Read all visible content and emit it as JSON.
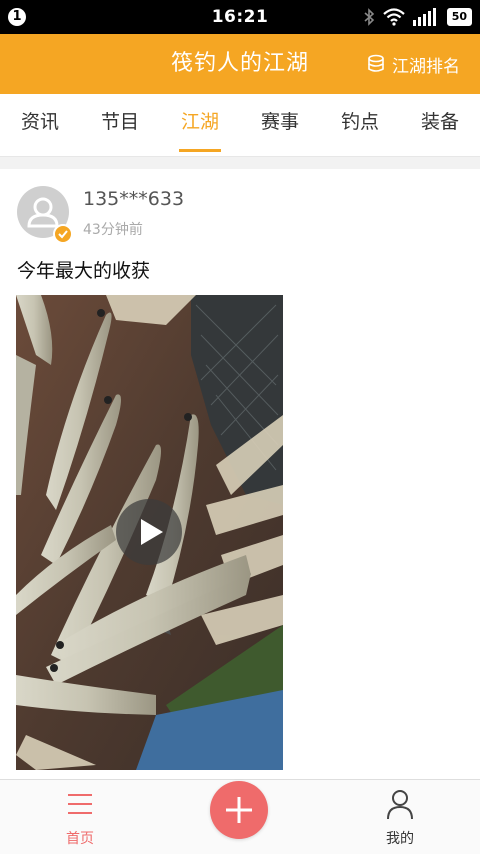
{
  "status_bar": {
    "notification_count": "1",
    "time": "16:21",
    "battery": "50",
    "icons": [
      "bluetooth-icon",
      "wifi-icon",
      "signal-icon",
      "battery-icon"
    ]
  },
  "header": {
    "title": "筏钓人的江湖",
    "rank_label": "江湖排名",
    "color": "#f5a623"
  },
  "tabs": [
    {
      "label": "资讯",
      "active": false
    },
    {
      "label": "节目",
      "active": false
    },
    {
      "label": "江湖",
      "active": true
    },
    {
      "label": "赛事",
      "active": false
    },
    {
      "label": "钓点",
      "active": false
    },
    {
      "label": "装备",
      "active": false
    }
  ],
  "post": {
    "username": "135***633",
    "time": "43分钟前",
    "title": "今年最大的收获",
    "media": {
      "type": "video",
      "icon": "play-icon"
    }
  },
  "bottom_nav": {
    "home_label": "首页",
    "mine_label": "我的",
    "add_icon": "plus-icon",
    "active_color": "#ef6b6b"
  }
}
